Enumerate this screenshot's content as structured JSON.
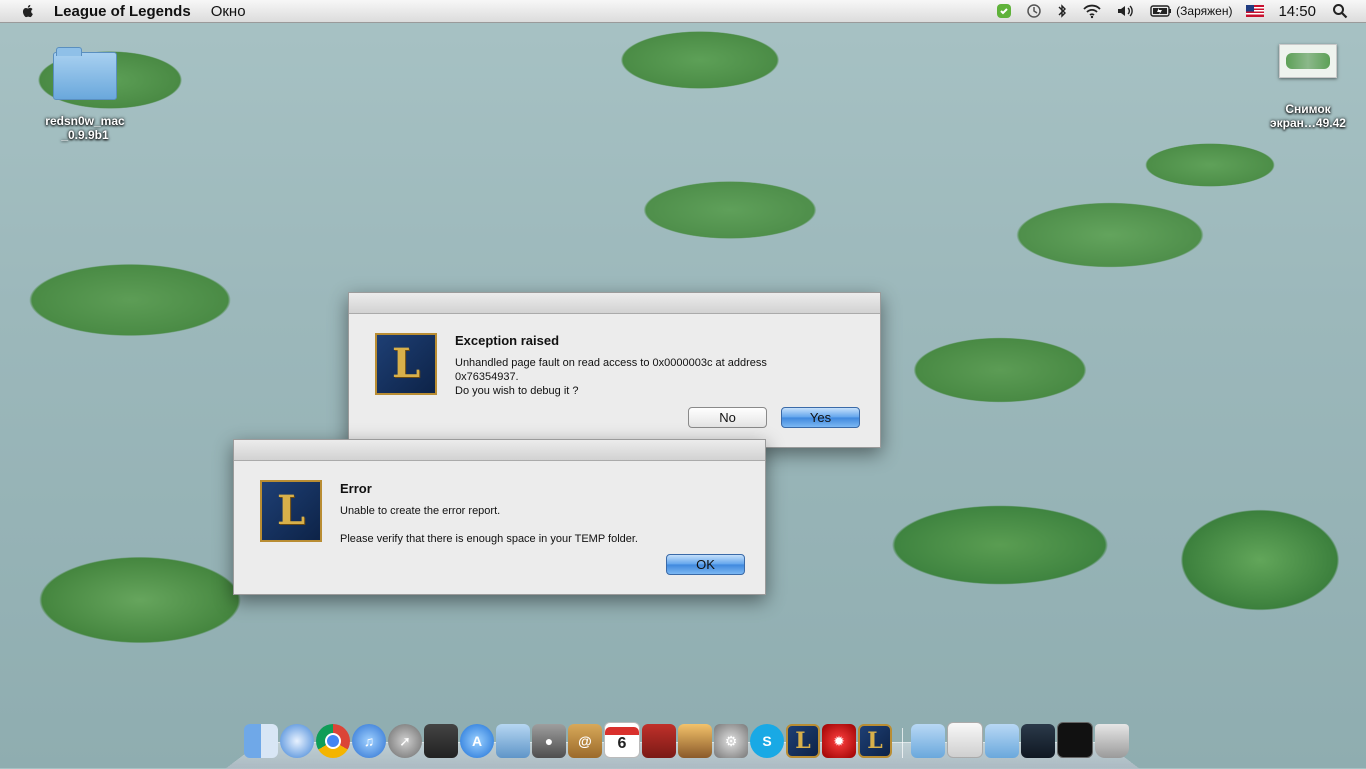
{
  "menubar": {
    "app_name": "League of Legends",
    "menu_items": [
      "Окно"
    ],
    "battery_label": "(Заряжен)",
    "clock": "14:50"
  },
  "desktop": {
    "folder_label": "redsn0w_mac _0.9.9b1",
    "screenshot_label_1": "Снимок",
    "screenshot_label_2": "экран…49.42"
  },
  "exception_dialog": {
    "title": "Exception raised",
    "message_line1": "Unhandled page fault on read access to 0x0000003c at address",
    "message_line2": "0x76354937.",
    "message_line3": "Do you wish to debug it ?",
    "no_label": "No",
    "yes_label": "Yes",
    "logo_letter": "L"
  },
  "error_dialog": {
    "title": "Error",
    "message_line1": "Unable to create the error report.",
    "message_line2": "Please verify that there is enough space in your TEMP folder.",
    "ok_label": "OK",
    "logo_letter": "L"
  },
  "dock": {
    "items": [
      "finder-icon",
      "safari-icon",
      "chrome-icon",
      "itunes-icon",
      "launchpad-icon",
      "photo-booth-icon",
      "app-store-icon",
      "preview-icon",
      "facetime-icon",
      "contacts-icon",
      "calendar-icon",
      "photo-icon",
      "iphoto-icon",
      "system-preferences-icon",
      "skype-icon",
      "league-of-legends-icon",
      "game-icon",
      "league-of-legends-icon-2",
      "downloads-icon",
      "documents-icon",
      "folder-icon",
      "screenshot-icon",
      "terminal-icon",
      "trash-icon"
    ],
    "calendar_day": "6"
  },
  "colors": {
    "default_button": "#3f88dd",
    "dialog_bg": "#ececec",
    "logo_gold": "#d8b04a",
    "logo_blue": "#1e3f74"
  }
}
